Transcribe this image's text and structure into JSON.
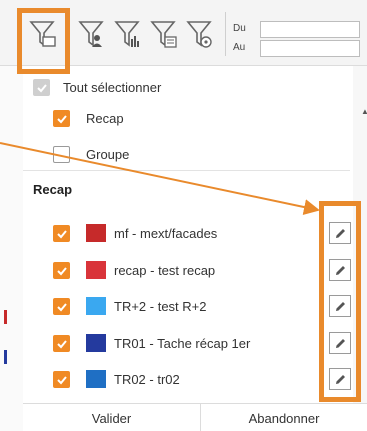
{
  "toolbar": {
    "date_from_label": "Du",
    "date_to_label": "Au",
    "date_from_value": "",
    "date_to_value": ""
  },
  "panel": {
    "select_all_label": "Tout sélectionner",
    "options": [
      {
        "label": "Recap",
        "checked": true
      },
      {
        "label": "Groupe",
        "checked": false
      }
    ],
    "group_title": "Recap",
    "items": [
      {
        "label": "mf - mext/facades",
        "checked": true,
        "color": "#c62a2a"
      },
      {
        "label": "recap - test recap",
        "checked": true,
        "color": "#d9343a"
      },
      {
        "label": "TR+2 - test R+2",
        "checked": true,
        "color": "#3aa8f0"
      },
      {
        "label": "TR01 - Tache récap 1er",
        "checked": true,
        "color": "#243a9e"
      },
      {
        "label": "TR02 - tr02",
        "checked": true,
        "color": "#1f6fc4"
      }
    ]
  },
  "footer": {
    "validate_label": "Valider",
    "cancel_label": "Abandonner"
  },
  "colors": {
    "accent": "#f08a24",
    "highlight": "#e98a2c"
  }
}
